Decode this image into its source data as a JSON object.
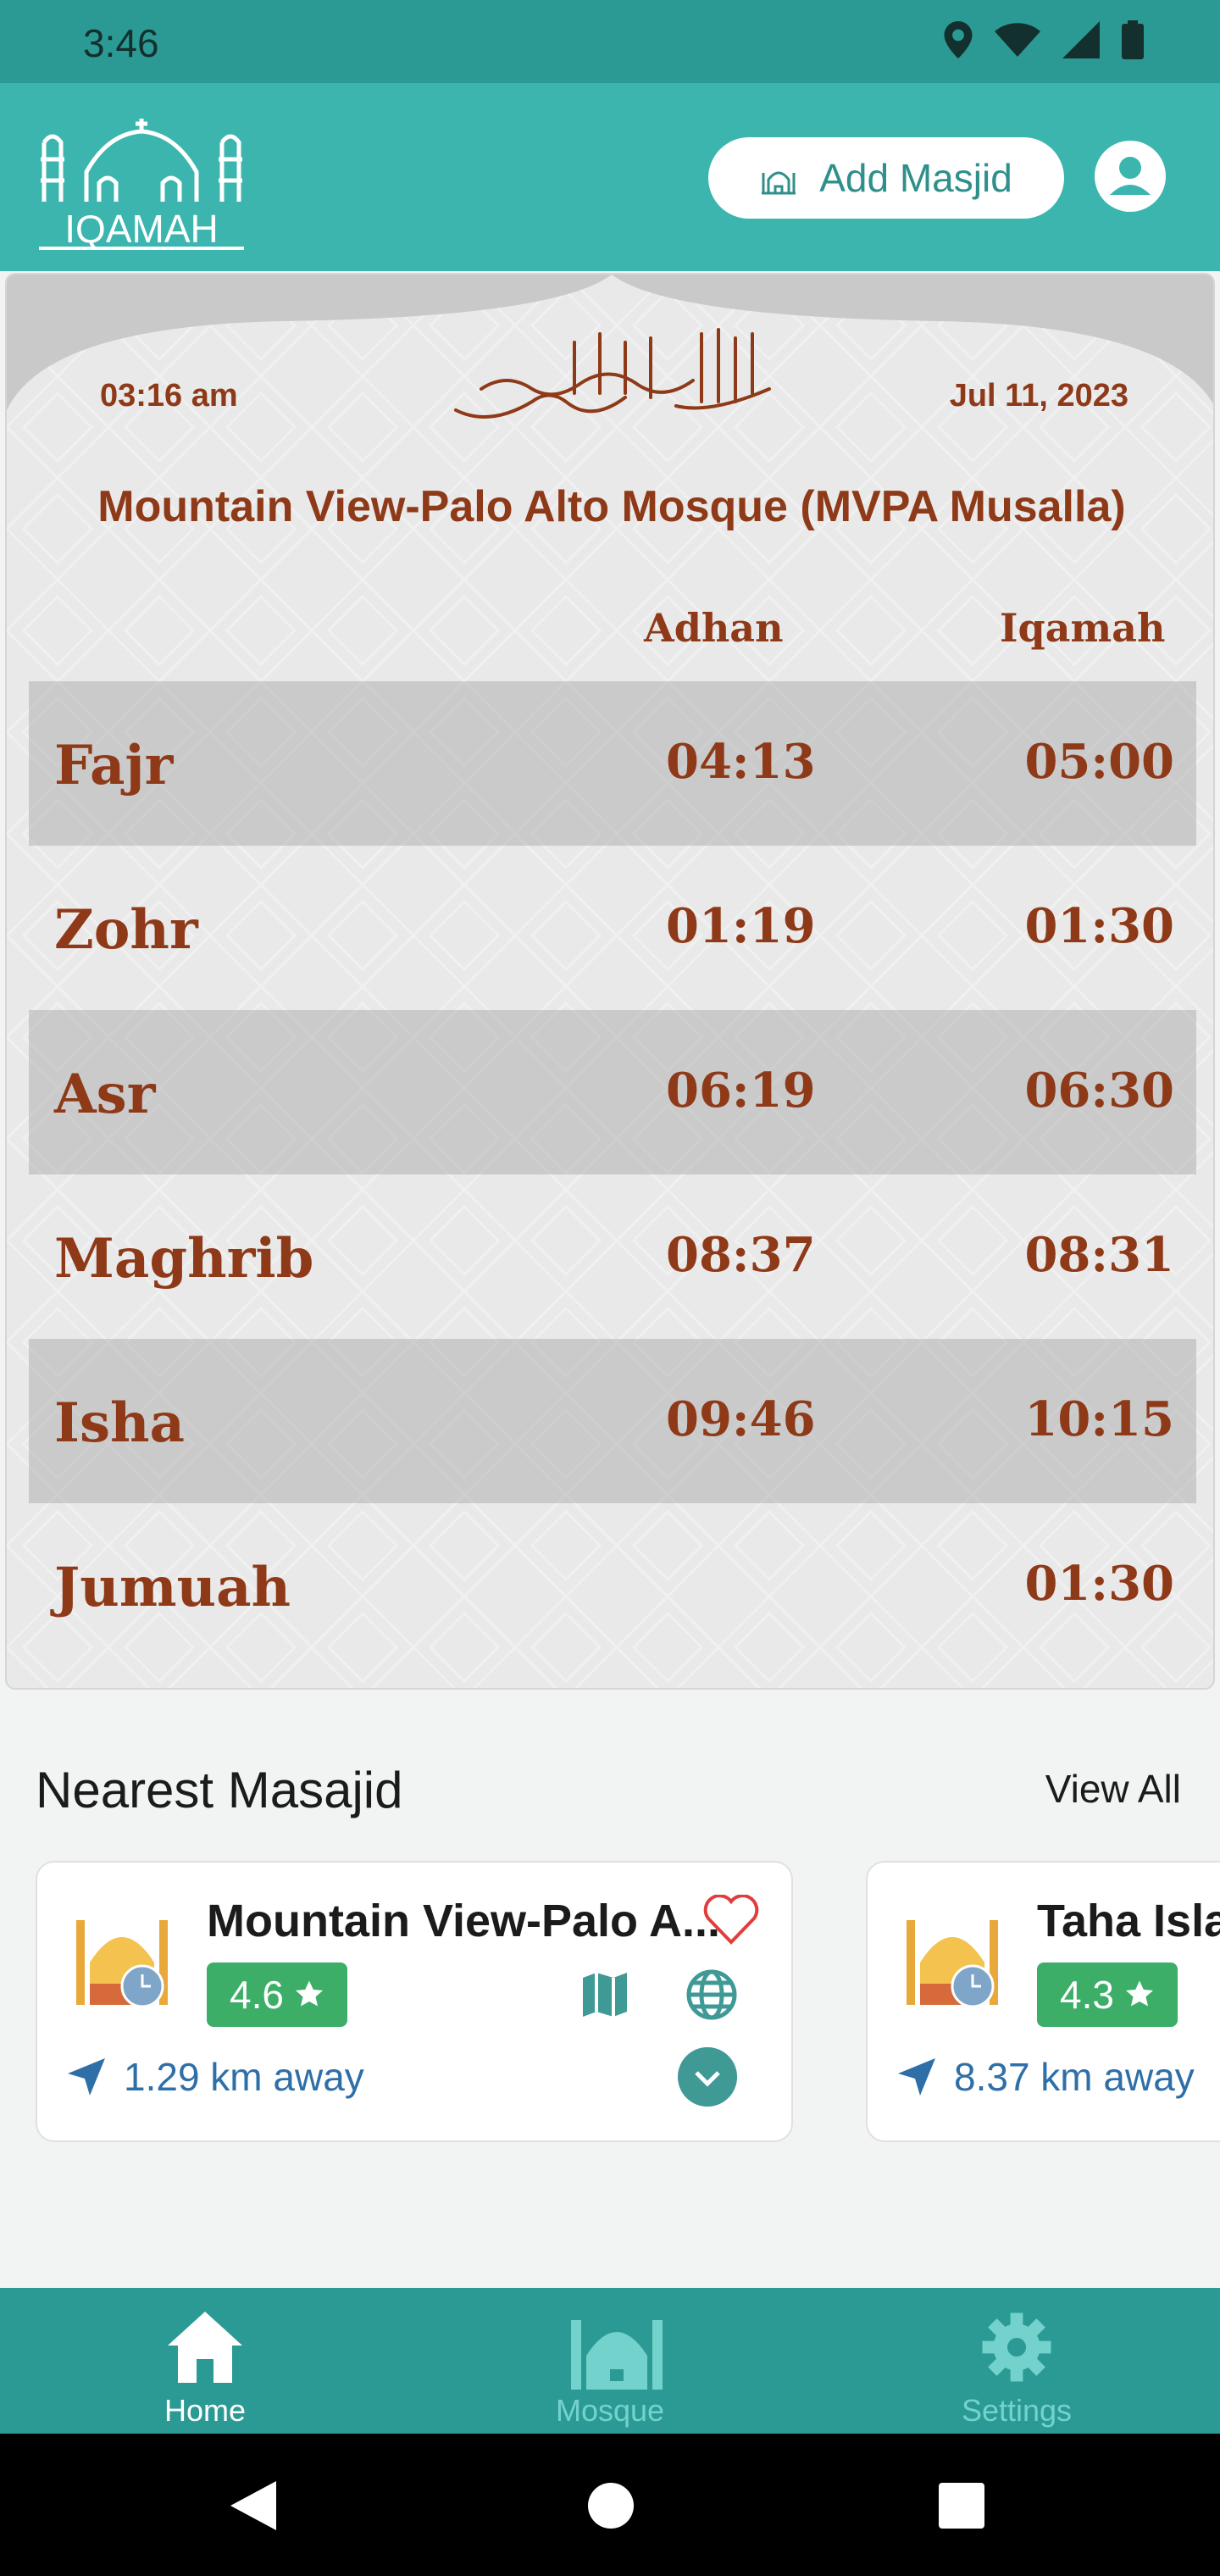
{
  "status_bar": {
    "time": "3:46"
  },
  "header": {
    "logo_text": "IQAMAH",
    "add_masjid_label": "Add Masjid"
  },
  "prayer_card": {
    "current_time": "03:16 am",
    "date": "Jul 11, 2023",
    "mosque_name": "Mountain View-Palo Alto Mosque (MVPA Musalla)",
    "adhan_header": "Adhan",
    "iqamah_header": "Iqamah",
    "prayers": [
      {
        "name": "Fajr",
        "adhan": "04:13",
        "iqamah": "05:00"
      },
      {
        "name": "Zohr",
        "adhan": "01:19",
        "iqamah": "01:30"
      },
      {
        "name": "Asr",
        "adhan": "06:19",
        "iqamah": "06:30"
      },
      {
        "name": "Maghrib",
        "adhan": "08:37",
        "iqamah": "08:31"
      },
      {
        "name": "Isha",
        "adhan": "09:46",
        "iqamah": "10:15"
      },
      {
        "name": "Jumuah",
        "adhan": "",
        "iqamah": "01:30"
      }
    ]
  },
  "nearest": {
    "title": "Nearest Masajid",
    "view_all_label": "View All",
    "cards": [
      {
        "name": "Mountain View-Palo A...",
        "rating": "4.6",
        "distance": "1.29 km away"
      },
      {
        "name": "Taha Isla",
        "rating": "4.3",
        "distance": "8.37 km away"
      }
    ]
  },
  "bottom_nav": {
    "items": [
      {
        "label": "Home"
      },
      {
        "label": "Mosque"
      },
      {
        "label": "Settings"
      }
    ]
  },
  "colors": {
    "primary": "#3bb5ae",
    "dark_primary": "#2c9a94",
    "accent_text": "#8e3a18",
    "rating_green": "#3dae67"
  }
}
